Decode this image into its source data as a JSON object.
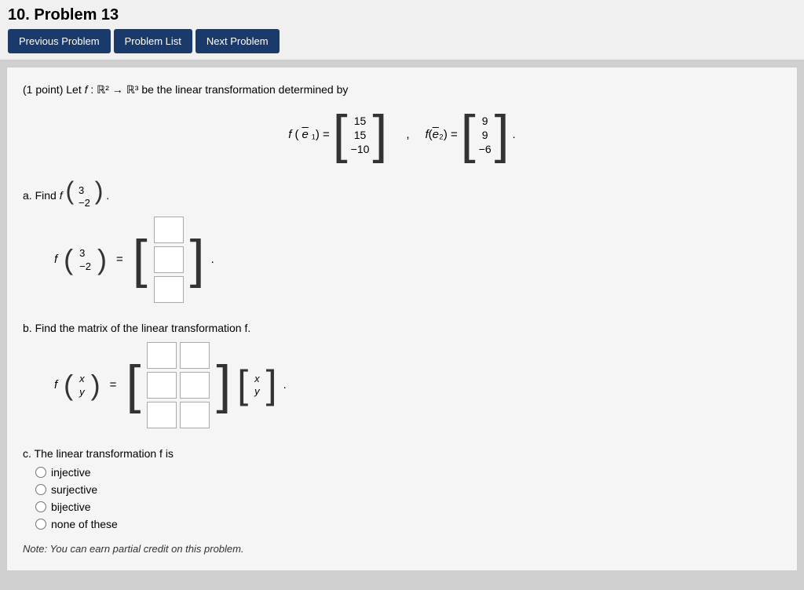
{
  "header": {
    "title": "10. Problem 13",
    "prev_label": "Previous Problem",
    "list_label": "Problem List",
    "next_label": "Next Problem"
  },
  "problem": {
    "points": "(1 point)",
    "description": "Let f : ℝ² → ℝ³ be the linear transformation determined by",
    "f_e1_label": "f(ē₁) =",
    "f_e1_values": [
      "15",
      "15",
      "−10"
    ],
    "f_e2_label": "f(ē₂) =",
    "f_e2_values": [
      "9",
      "9",
      "−6"
    ],
    "part_a_label": "a. Find f",
    "part_a_vec": [
      "3",
      "−2"
    ],
    "part_b_label": "b. Find the matrix of the linear transformation f.",
    "part_c_label": "c. The linear transformation f is",
    "radio_options": [
      "injective",
      "surjective",
      "bijective",
      "none of these"
    ],
    "note": "Note: You can earn partial credit on this problem."
  }
}
